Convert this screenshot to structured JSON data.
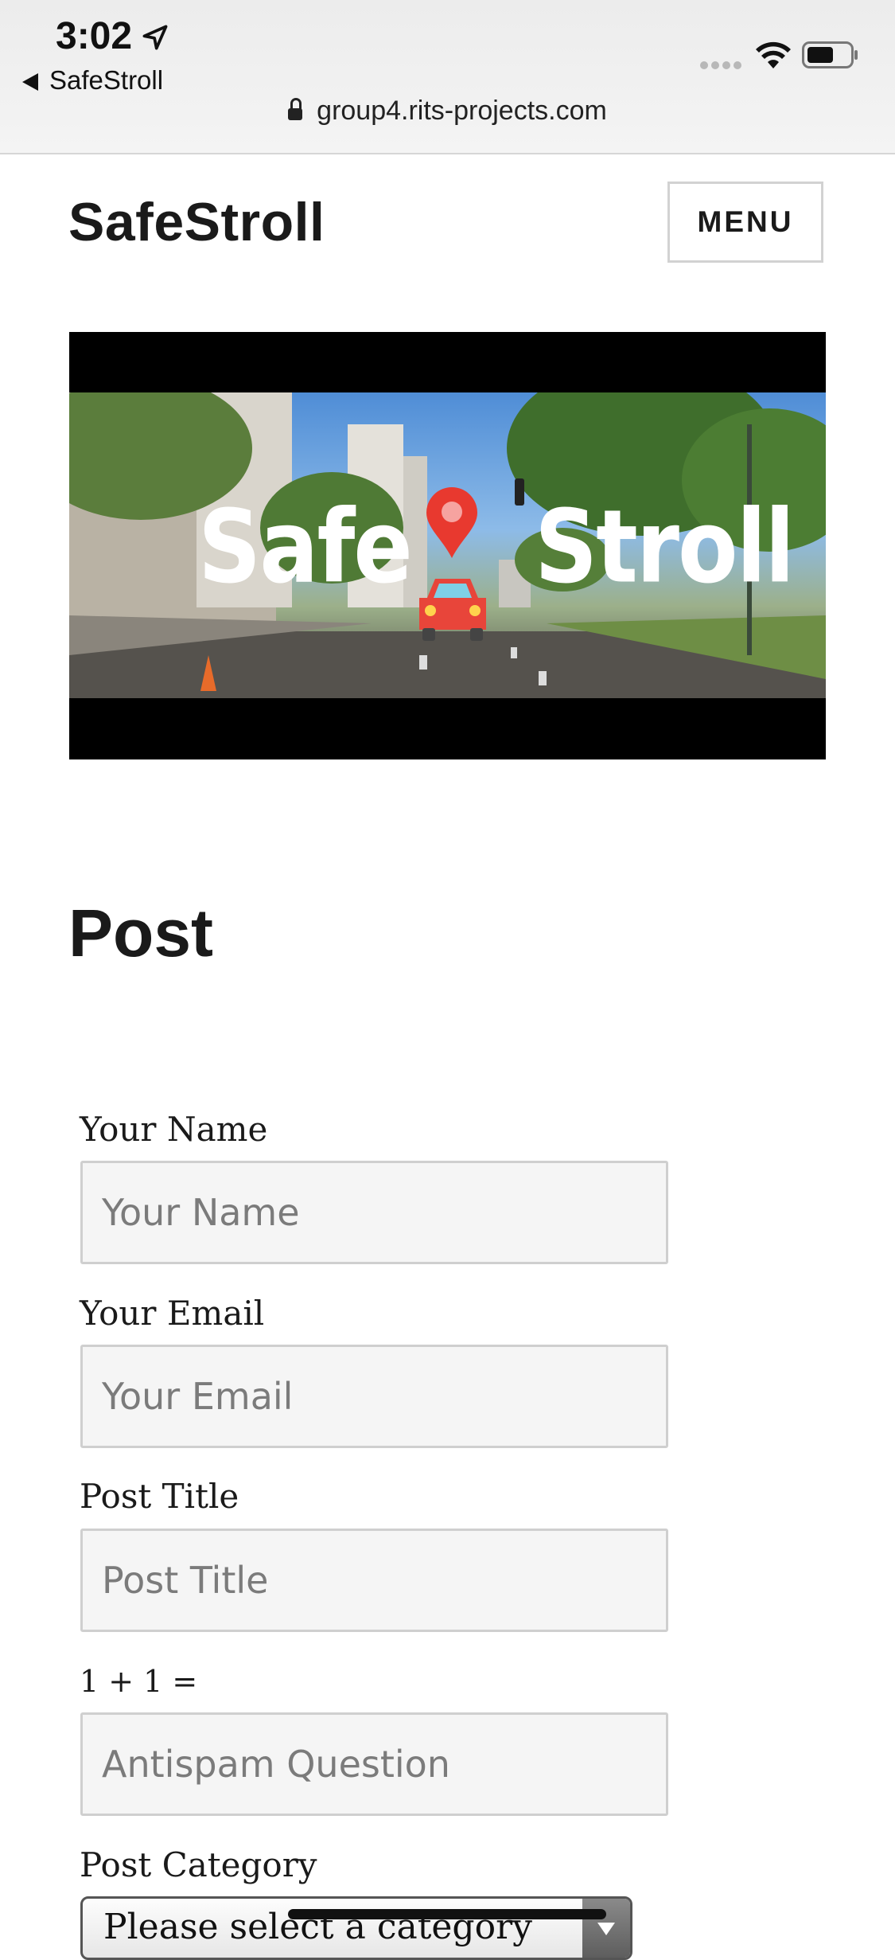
{
  "status_bar": {
    "time": "3:02",
    "back_label": "SafeStroll",
    "url": "group4.rits-projects.com",
    "icons": [
      "location-arrow-icon",
      "signal-dots-icon",
      "wifi-icon",
      "battery-icon",
      "lock-icon"
    ]
  },
  "header": {
    "site_title": "SafeStroll",
    "menu_label": "MENU"
  },
  "hero": {
    "text_left": "Safe",
    "text_right": "Stroll",
    "icons": [
      "map-pin-icon",
      "car-icon"
    ]
  },
  "page": {
    "title": "Post"
  },
  "form": {
    "name_label": "Your Name",
    "name_placeholder": "Your Name",
    "email_label": "Your Email",
    "email_placeholder": "Your Email",
    "post_title_label": "Post Title",
    "post_title_placeholder": "Post Title",
    "antispam_label": "1 + 1 =",
    "antispam_placeholder": "Antispam Question",
    "category_label": "Post Category",
    "category_selected": "Please select a category"
  },
  "colors": {
    "pin": "#e8392f",
    "car": "#e8453a",
    "field_bg": "#f5f5f5",
    "field_border": "#cfcfcf"
  }
}
